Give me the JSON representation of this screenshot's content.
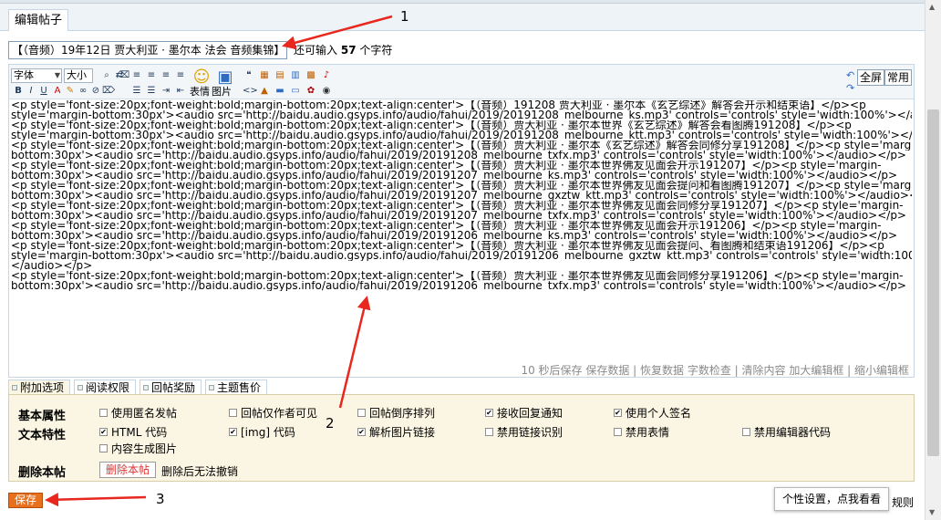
{
  "tab_title": "编辑帖子",
  "subject": {
    "value": "【（音频）19年12日 贾大利亚 · 墨尔本 法会 音频集锦】",
    "hint_prefix": "还可输入",
    "hint_count": "57",
    "hint_suffix": "个字符"
  },
  "toolbar": {
    "font_label": "字体",
    "size_label": "大小",
    "emoji_label": "表情",
    "image_label": "图片",
    "fullscreen_label": "全屏",
    "common_label": "常用"
  },
  "editor_lines": [
    "<p style='font-size:20px;font-weight:bold;margin-bottom:20px;text-align:center'>【（音频）191208 贾大利亚 · 墨尔本《玄艺综述》解答会开示和结束语】</p><p",
    "style='margin-bottom:30px'><audio src='http://baidu.audio.gsyps.info/audio/fahui/2019/20191208_melbourne_ks.mp3' controls='controls' style='width:100%'></audio></p>",
    "<p style='font-size:20px;font-weight:bold;margin-bottom:20px;text-align:center'>【（音频）贾大利亚 · 墨尔本世界《玄艺综述》解答会看图腾191208】</p><p",
    "style='margin-bottom:30px'><audio src='http://baidu.audio.gsyps.info/audio/fahui/2019/20191208_melbourne_ktt.mp3' controls='controls' style='width:100%'></audio></p>",
    "<p style='font-size:20px;font-weight:bold;margin-bottom:20px;text-align:center'>【（音频）贾大利亚 · 墨尔本《玄艺综述》解答会同修分享191208】</p><p style='margin-",
    "bottom:30px'><audio src='http://baidu.audio.gsyps.info/audio/fahui/2019/20191208_melbourne_txfx.mp3' controls='controls' style='width:100%'></audio></p>",
    "<p style='font-size:20px;font-weight:bold;margin-bottom:20px;text-align:center'>【（音频）贾大利亚 · 墨尔本世界佛友见面会开示191207】</p><p style='margin-",
    "bottom:30px'><audio src='http://baidu.audio.gsyps.info/audio/fahui/2019/20191207_melbourne_ks.mp3' controls='controls' style='width:100%'></audio></p>",
    "<p style='font-size:20px;font-weight:bold;margin-bottom:20px;text-align:center'>【（音频）贾大利亚 · 墨尔本世界佛友见面会提问和看图腾191207】</p><p style='margin-",
    "bottom:30px'><audio src='http://baidu.audio.gsyps.info/audio/fahui/2019/20191207_melbourne_gxztw_ktt.mp3' controls='controls' style='width:100%'></audio></p>",
    "<p style='font-size:20px;font-weight:bold;margin-bottom:20px;text-align:center'>【（音频）贾大利亚 · 墨尔本世界佛友见面会同修分享191207】</p><p style='margin-",
    "bottom:30px'><audio src='http://baidu.audio.gsyps.info/audio/fahui/2019/20191207_melbourne_txfx.mp3' controls='controls' style='width:100%'></audio></p>",
    "<p style='font-size:20px;font-weight:bold;margin-bottom:20px;text-align:center'>【（音频）贾大利亚 · 墨尔本世界佛友见面会开示191206】</p><p style='margin-",
    "bottom:30px'><audio src='http://baidu.audio.gsyps.info/audio/fahui/2019/20191206_melbourne_ks.mp3' controls='controls' style='width:100%'></audio></p>",
    "<p style='font-size:20px;font-weight:bold;margin-bottom:20px;text-align:center'>【（音频）贾大利亚 · 墨尔本世界佛友见面会提问、看图腾和结束语191206】</p><p",
    "style='margin-bottom:30px'><audio src='http://baidu.audio.gsyps.info/audio/fahui/2019/20191206_melbourne_gxztw_ktt.mp3' controls='controls' style='width:100%'>",
    "</audio></p>",
    "<p style='font-size:20px;font-weight:bold;margin-bottom:20px;text-align:center'>【（音频）贾大利亚 · 墨尔本世界佛友见面会同修分享191206】</p><p style='margin-",
    "bottom:30px'><audio src='http://baidu.audio.gsyps.info/audio/fahui/2019/20191206_melbourne_txfx.mp3' controls='controls' style='width:100%'></audio></p>"
  ],
  "status_bar": "10 秒后保存 保存数据 | 恢复数据    字数检查 | 清除内容    加大编辑框 | 缩小编辑框",
  "option_tabs": [
    "附加选项",
    "阅读权限",
    "回帖奖励",
    "主题售价"
  ],
  "options": {
    "row1_label": "基本属性",
    "row2_label": "文本特性",
    "row3_label": "删除本帖",
    "row1": [
      {
        "label": "使用匿名发帖",
        "checked": false
      },
      {
        "label": "回帖仅作者可见",
        "checked": false
      },
      {
        "label": "回帖倒序排列",
        "checked": false
      },
      {
        "label": "接收回复通知",
        "checked": true
      },
      {
        "label": "使用个人签名",
        "checked": true
      }
    ],
    "row2": [
      {
        "label": "HTML 代码",
        "checked": true
      },
      {
        "label": "[img] 代码",
        "checked": true
      },
      {
        "label": "解析图片链接",
        "checked": true
      },
      {
        "label": "禁用链接识别",
        "checked": false
      },
      {
        "label": "禁用表情",
        "checked": false
      },
      {
        "label": "禁用编辑器代码",
        "checked": false
      }
    ],
    "row2b": [
      {
        "label": "内容生成图片",
        "checked": false
      }
    ],
    "delete_button": "删除本帖",
    "delete_note": "删除后无法撤销"
  },
  "save_button": "保存",
  "tooltip": "个性设置，点我看看",
  "rules_text": "规则",
  "annotations": [
    "1",
    "2",
    "3"
  ],
  "colors": {
    "save": "#e8701d",
    "arrow": "#e8271e",
    "options_bg": "#fbf6e4"
  }
}
